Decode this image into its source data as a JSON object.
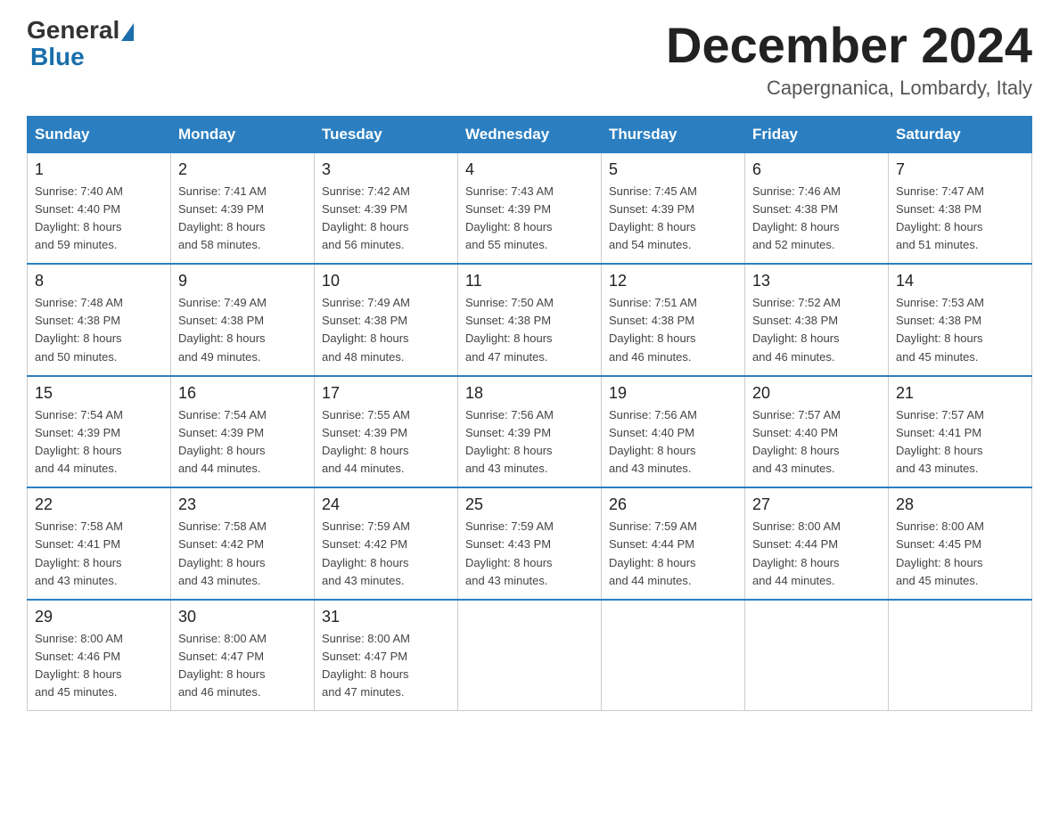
{
  "header": {
    "logo_general": "General",
    "logo_blue": "Blue",
    "month_title": "December 2024",
    "location": "Capergnanica, Lombardy, Italy"
  },
  "days_of_week": [
    "Sunday",
    "Monday",
    "Tuesday",
    "Wednesday",
    "Thursday",
    "Friday",
    "Saturday"
  ],
  "weeks": [
    [
      {
        "day": "1",
        "sunrise": "7:40 AM",
        "sunset": "4:40 PM",
        "daylight": "8 hours and 59 minutes."
      },
      {
        "day": "2",
        "sunrise": "7:41 AM",
        "sunset": "4:39 PM",
        "daylight": "8 hours and 58 minutes."
      },
      {
        "day": "3",
        "sunrise": "7:42 AM",
        "sunset": "4:39 PM",
        "daylight": "8 hours and 56 minutes."
      },
      {
        "day": "4",
        "sunrise": "7:43 AM",
        "sunset": "4:39 PM",
        "daylight": "8 hours and 55 minutes."
      },
      {
        "day": "5",
        "sunrise": "7:45 AM",
        "sunset": "4:39 PM",
        "daylight": "8 hours and 54 minutes."
      },
      {
        "day": "6",
        "sunrise": "7:46 AM",
        "sunset": "4:38 PM",
        "daylight": "8 hours and 52 minutes."
      },
      {
        "day": "7",
        "sunrise": "7:47 AM",
        "sunset": "4:38 PM",
        "daylight": "8 hours and 51 minutes."
      }
    ],
    [
      {
        "day": "8",
        "sunrise": "7:48 AM",
        "sunset": "4:38 PM",
        "daylight": "8 hours and 50 minutes."
      },
      {
        "day": "9",
        "sunrise": "7:49 AM",
        "sunset": "4:38 PM",
        "daylight": "8 hours and 49 minutes."
      },
      {
        "day": "10",
        "sunrise": "7:49 AM",
        "sunset": "4:38 PM",
        "daylight": "8 hours and 48 minutes."
      },
      {
        "day": "11",
        "sunrise": "7:50 AM",
        "sunset": "4:38 PM",
        "daylight": "8 hours and 47 minutes."
      },
      {
        "day": "12",
        "sunrise": "7:51 AM",
        "sunset": "4:38 PM",
        "daylight": "8 hours and 46 minutes."
      },
      {
        "day": "13",
        "sunrise": "7:52 AM",
        "sunset": "4:38 PM",
        "daylight": "8 hours and 46 minutes."
      },
      {
        "day": "14",
        "sunrise": "7:53 AM",
        "sunset": "4:38 PM",
        "daylight": "8 hours and 45 minutes."
      }
    ],
    [
      {
        "day": "15",
        "sunrise": "7:54 AM",
        "sunset": "4:39 PM",
        "daylight": "8 hours and 44 minutes."
      },
      {
        "day": "16",
        "sunrise": "7:54 AM",
        "sunset": "4:39 PM",
        "daylight": "8 hours and 44 minutes."
      },
      {
        "day": "17",
        "sunrise": "7:55 AM",
        "sunset": "4:39 PM",
        "daylight": "8 hours and 44 minutes."
      },
      {
        "day": "18",
        "sunrise": "7:56 AM",
        "sunset": "4:39 PM",
        "daylight": "8 hours and 43 minutes."
      },
      {
        "day": "19",
        "sunrise": "7:56 AM",
        "sunset": "4:40 PM",
        "daylight": "8 hours and 43 minutes."
      },
      {
        "day": "20",
        "sunrise": "7:57 AM",
        "sunset": "4:40 PM",
        "daylight": "8 hours and 43 minutes."
      },
      {
        "day": "21",
        "sunrise": "7:57 AM",
        "sunset": "4:41 PM",
        "daylight": "8 hours and 43 minutes."
      }
    ],
    [
      {
        "day": "22",
        "sunrise": "7:58 AM",
        "sunset": "4:41 PM",
        "daylight": "8 hours and 43 minutes."
      },
      {
        "day": "23",
        "sunrise": "7:58 AM",
        "sunset": "4:42 PM",
        "daylight": "8 hours and 43 minutes."
      },
      {
        "day": "24",
        "sunrise": "7:59 AM",
        "sunset": "4:42 PM",
        "daylight": "8 hours and 43 minutes."
      },
      {
        "day": "25",
        "sunrise": "7:59 AM",
        "sunset": "4:43 PM",
        "daylight": "8 hours and 43 minutes."
      },
      {
        "day": "26",
        "sunrise": "7:59 AM",
        "sunset": "4:44 PM",
        "daylight": "8 hours and 44 minutes."
      },
      {
        "day": "27",
        "sunrise": "8:00 AM",
        "sunset": "4:44 PM",
        "daylight": "8 hours and 44 minutes."
      },
      {
        "day": "28",
        "sunrise": "8:00 AM",
        "sunset": "4:45 PM",
        "daylight": "8 hours and 45 minutes."
      }
    ],
    [
      {
        "day": "29",
        "sunrise": "8:00 AM",
        "sunset": "4:46 PM",
        "daylight": "8 hours and 45 minutes."
      },
      {
        "day": "30",
        "sunrise": "8:00 AM",
        "sunset": "4:47 PM",
        "daylight": "8 hours and 46 minutes."
      },
      {
        "day": "31",
        "sunrise": "8:00 AM",
        "sunset": "4:47 PM",
        "daylight": "8 hours and 47 minutes."
      },
      null,
      null,
      null,
      null
    ]
  ],
  "labels": {
    "sunrise": "Sunrise:",
    "sunset": "Sunset:",
    "daylight": "Daylight:"
  }
}
